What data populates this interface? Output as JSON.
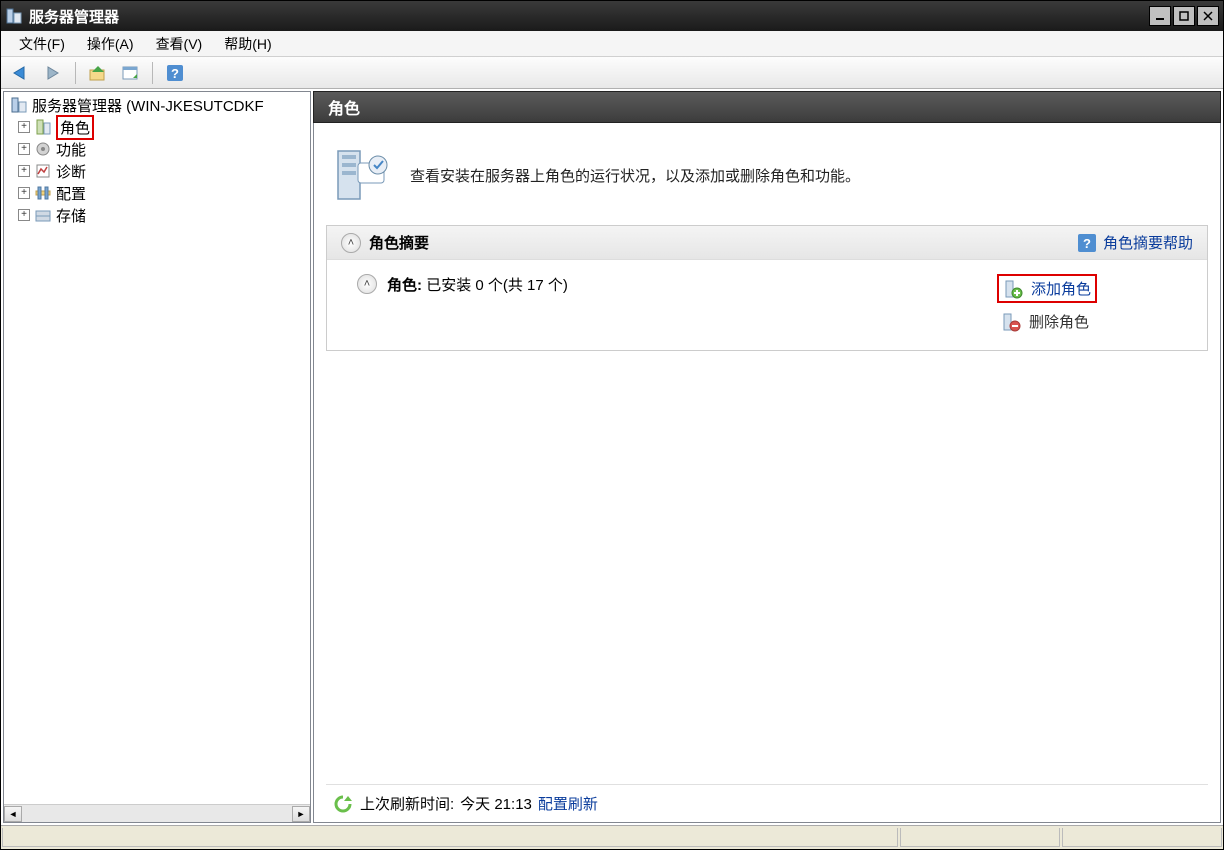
{
  "window": {
    "title": "服务器管理器"
  },
  "menu": {
    "file": "文件(F)",
    "action": "操作(A)",
    "view": "查看(V)",
    "help": "帮助(H)"
  },
  "tree": {
    "root": "服务器管理器 (WIN-JKESUTCDKF",
    "items": [
      "角色",
      "功能",
      "诊断",
      "配置",
      "存储"
    ]
  },
  "content": {
    "header": "角色",
    "intro": "查看安装在服务器上角色的运行状况，以及添加或删除角色和功能。",
    "summary": {
      "title": "角色摘要",
      "help": "角色摘要帮助",
      "roles_label": "角色",
      "roles_count_text": "已安装 0 个(共 17 个)",
      "add_role": "添加角色",
      "remove_role": "删除角色"
    },
    "footer": {
      "last_refresh_label": "上次刷新时间:",
      "last_refresh_value": "今天 21:13",
      "config_refresh": "配置刷新"
    }
  }
}
